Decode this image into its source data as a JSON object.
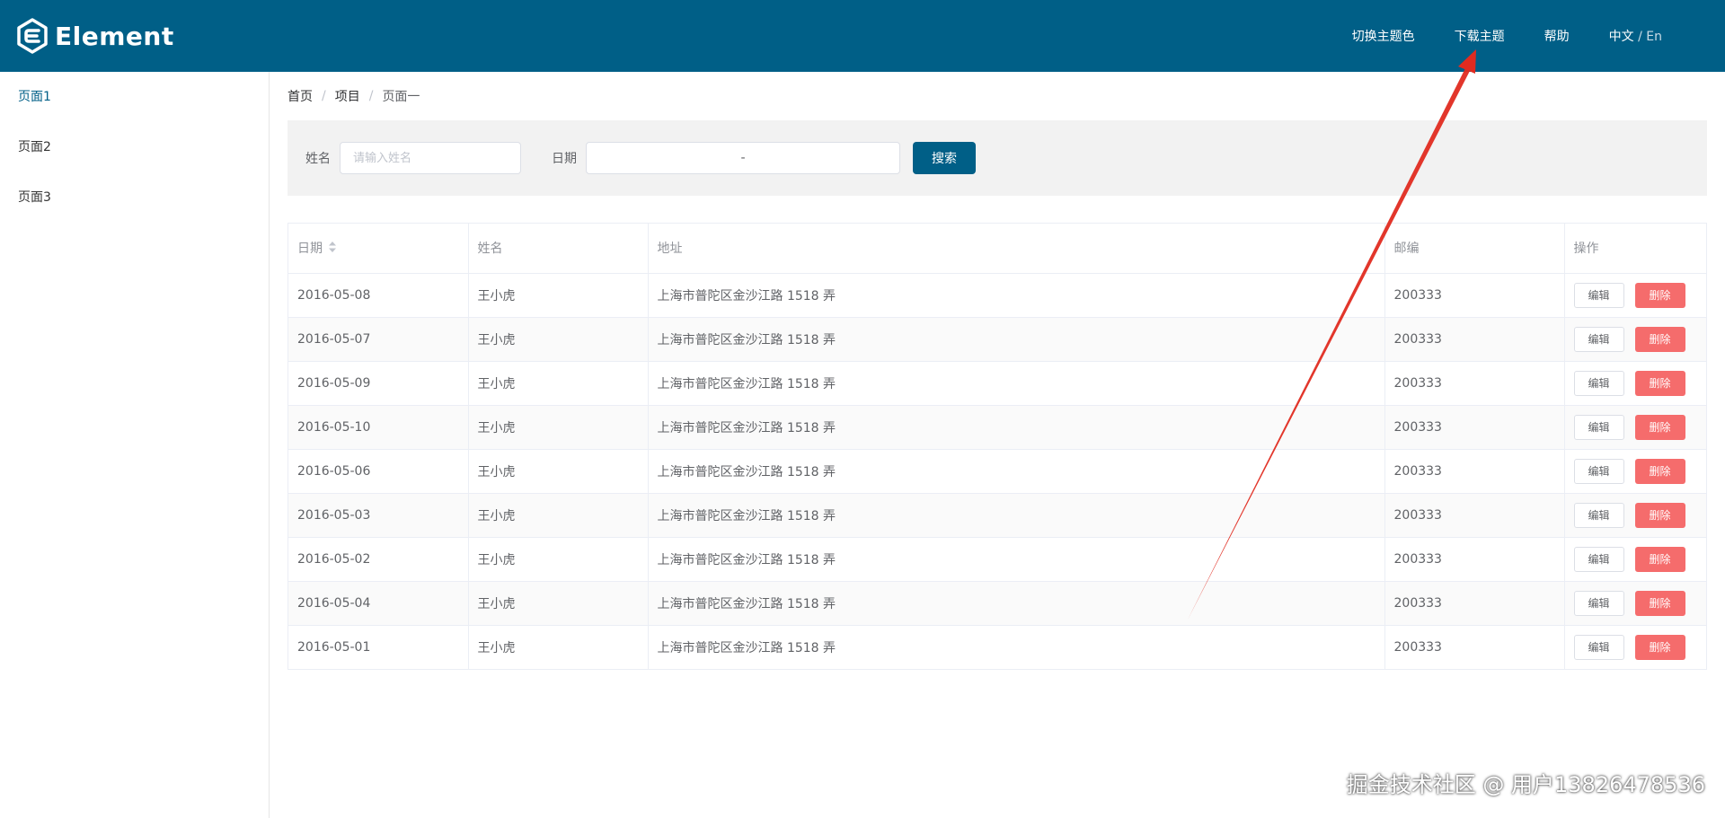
{
  "header": {
    "logo_text": "Element",
    "nav": [
      "切换主题色",
      "下载主题",
      "帮助"
    ],
    "lang_zh": "中文",
    "lang_sep": " / ",
    "lang_en": "En"
  },
  "sidebar": {
    "items": [
      "页面1",
      "页面2",
      "页面3"
    ],
    "active_index": 0
  },
  "breadcrumb": [
    "首页",
    "项目",
    "页面一"
  ],
  "search": {
    "name_label": "姓名",
    "name_placeholder": "请输入姓名",
    "date_label": "日期",
    "date_separator": "-",
    "search_button": "搜索"
  },
  "table": {
    "columns": [
      "日期",
      "姓名",
      "地址",
      "邮编",
      "操作"
    ],
    "rows": [
      [
        "2016-05-08",
        "王小虎",
        "上海市普陀区金沙江路 1518 弄",
        "200333"
      ],
      [
        "2016-05-07",
        "王小虎",
        "上海市普陀区金沙江路 1518 弄",
        "200333"
      ],
      [
        "2016-05-09",
        "王小虎",
        "上海市普陀区金沙江路 1518 弄",
        "200333"
      ],
      [
        "2016-05-10",
        "王小虎",
        "上海市普陀区金沙江路 1518 弄",
        "200333"
      ],
      [
        "2016-05-06",
        "王小虎",
        "上海市普陀区金沙江路 1518 弄",
        "200333"
      ],
      [
        "2016-05-03",
        "王小虎",
        "上海市普陀区金沙江路 1518 弄",
        "200333"
      ],
      [
        "2016-05-02",
        "王小虎",
        "上海市普陀区金沙江路 1518 弄",
        "200333"
      ],
      [
        "2016-05-04",
        "王小虎",
        "上海市普陀区金沙江路 1518 弄",
        "200333"
      ],
      [
        "2016-05-01",
        "王小虎",
        "上海市普陀区金沙江路 1518 弄",
        "200333"
      ]
    ],
    "edit_label": "编辑",
    "delete_label": "删除"
  },
  "watermark": "掘金技术社区 @ 用户13826478536",
  "colors": {
    "primary": "#005f87",
    "danger": "#f56c6c",
    "annotation_arrow": "#e02b20"
  },
  "icons": [
    "element-logo-icon",
    "sort-caret-icon",
    "annotation-arrow"
  ]
}
